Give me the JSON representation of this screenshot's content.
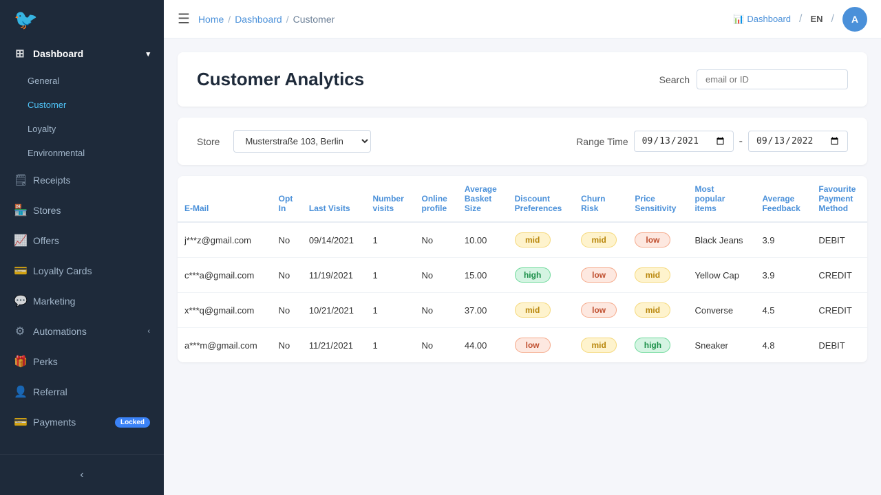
{
  "sidebar": {
    "logo_icon": "🐦",
    "items": [
      {
        "id": "dashboard",
        "label": "Dashboard",
        "icon": "⊞",
        "has_chevron": true,
        "active": false
      },
      {
        "id": "general",
        "label": "General",
        "icon": "",
        "indent": true,
        "active": false
      },
      {
        "id": "customer",
        "label": "Customer",
        "icon": "",
        "indent": true,
        "active": true
      },
      {
        "id": "loyalty",
        "label": "Loyalty",
        "icon": "",
        "indent": true,
        "active": false
      },
      {
        "id": "environmental",
        "label": "Environmental",
        "icon": "",
        "indent": true,
        "active": false
      },
      {
        "id": "receipts",
        "label": "Receipts",
        "icon": "🗒",
        "active": false
      },
      {
        "id": "stores",
        "label": "Stores",
        "icon": "🏪",
        "active": false
      },
      {
        "id": "offers",
        "label": "Offers",
        "icon": "📈",
        "active": false
      },
      {
        "id": "loyalty-cards",
        "label": "Loyalty Cards",
        "icon": "💳",
        "active": false
      },
      {
        "id": "marketing",
        "label": "Marketing",
        "icon": "💬",
        "active": false
      },
      {
        "id": "automations",
        "label": "Automations",
        "icon": "⚙",
        "has_chevron": true,
        "active": false
      },
      {
        "id": "perks",
        "label": "Perks",
        "icon": "🎁",
        "active": false
      },
      {
        "id": "referral",
        "label": "Referral",
        "icon": "👤",
        "active": false
      },
      {
        "id": "payments",
        "label": "Payments",
        "icon": "💳",
        "badge": "Locked",
        "active": false
      }
    ]
  },
  "topbar": {
    "breadcrumb": [
      "Home",
      "Dashboard",
      "Customer"
    ],
    "dashboard_link": "Dashboard",
    "lang": "EN",
    "avatar_initial": "A"
  },
  "page": {
    "title": "Customer Analytics",
    "search_label": "Search",
    "search_placeholder": "email or ID"
  },
  "filter": {
    "store_label": "Store",
    "store_value": "Musterstraße 103, Berlin",
    "range_label": "Range Time",
    "date_from": "09/13/2021",
    "date_to": "09/13/2022"
  },
  "table": {
    "columns": [
      "E-Mail",
      "Opt In",
      "Last Visits",
      "Number visits",
      "Online profile",
      "Average Basket Size",
      "Discount Preferences",
      "Churn Risk",
      "Price Sensitivity",
      "Most popular items",
      "Average Feedback",
      "Favourite Payment Method"
    ],
    "rows": [
      {
        "email": "j***z@gmail.com",
        "opt_in": "No",
        "last_visits": "09/14/2021",
        "number_visits": "1",
        "online_profile": "No",
        "basket_size": "10.00",
        "discount_pref": "mid",
        "discount_pref_class": "badge-mid",
        "churn_risk": "mid",
        "churn_risk_class": "badge-mid",
        "price_sensitivity": "low",
        "price_sensitivity_class": "badge-low",
        "popular_items": "Black Jeans",
        "avg_feedback": "3.9",
        "payment_method": "DEBIT"
      },
      {
        "email": "c***a@gmail.com",
        "opt_in": "No",
        "last_visits": "11/19/2021",
        "number_visits": "1",
        "online_profile": "No",
        "basket_size": "15.00",
        "discount_pref": "high",
        "discount_pref_class": "badge-high",
        "churn_risk": "low",
        "churn_risk_class": "badge-low",
        "price_sensitivity": "mid",
        "price_sensitivity_class": "badge-mid",
        "popular_items": "Yellow Cap",
        "avg_feedback": "3.9",
        "payment_method": "CREDIT"
      },
      {
        "email": "x***q@gmail.com",
        "opt_in": "No",
        "last_visits": "10/21/2021",
        "number_visits": "1",
        "online_profile": "No",
        "basket_size": "37.00",
        "discount_pref": "mid",
        "discount_pref_class": "badge-mid",
        "churn_risk": "low",
        "churn_risk_class": "badge-low",
        "price_sensitivity": "mid",
        "price_sensitivity_class": "badge-mid",
        "popular_items": "Converse",
        "avg_feedback": "4.5",
        "payment_method": "CREDIT"
      },
      {
        "email": "a***m@gmail.com",
        "opt_in": "No",
        "last_visits": "11/21/2021",
        "number_visits": "1",
        "online_profile": "No",
        "basket_size": "44.00",
        "discount_pref": "low",
        "discount_pref_class": "badge-low",
        "churn_risk": "mid",
        "churn_risk_class": "badge-mid",
        "price_sensitivity": "high",
        "price_sensitivity_class": "badge-high",
        "popular_items": "Sneaker",
        "avg_feedback": "4.8",
        "payment_method": "DEBIT"
      }
    ]
  }
}
